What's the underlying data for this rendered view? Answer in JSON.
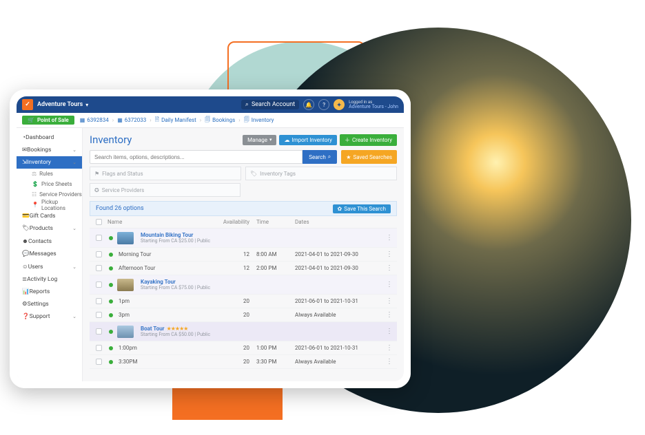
{
  "topbar": {
    "app": "Adventure Tours",
    "search_label": "Search Account",
    "logged_in_as": "Logged in as",
    "user_line": "Adventure Tours - John"
  },
  "pos_label": "Point of Sale",
  "breadcrumbs": [
    {
      "text": "6392834"
    },
    {
      "text": "6372033"
    },
    {
      "text": "Daily Manifest"
    },
    {
      "text": "Bookings"
    },
    {
      "text": "Inventory"
    }
  ],
  "sidebar": {
    "items": [
      {
        "label": "Dashboard"
      },
      {
        "label": "Bookings",
        "expandable": true
      },
      {
        "label": "Inventory",
        "expandable": true,
        "active": true,
        "children": [
          {
            "label": "Rules"
          },
          {
            "label": "Price Sheets"
          },
          {
            "label": "Service Providers"
          },
          {
            "label": "Pickup Locations"
          }
        ]
      },
      {
        "label": "Gift Cards"
      },
      {
        "label": "Products",
        "expandable": true
      },
      {
        "label": "Contacts"
      },
      {
        "label": "Messages"
      },
      {
        "label": "Users",
        "expandable": true
      },
      {
        "label": "Activity Log"
      },
      {
        "label": "Reports"
      },
      {
        "label": "Settings"
      },
      {
        "label": "Support",
        "expandable": true
      }
    ]
  },
  "page_title": "Inventory",
  "buttons": {
    "manage": "Manage",
    "import": "Import Inventory",
    "create": "Create Inventory",
    "saved_searches": "Saved Searches"
  },
  "search": {
    "placeholder": "Search items, options, descriptions...",
    "label": "Search"
  },
  "filters": {
    "flags": "Flags and Status",
    "tags": "Inventory Tags",
    "providers": "Service Providers"
  },
  "found": {
    "text": "Found 26 options",
    "save": "Save This Search"
  },
  "columns": {
    "name": "Name",
    "availability": "Availability",
    "time": "Time",
    "dates": "Dates"
  },
  "rows": [
    {
      "type": "prod",
      "name": "Mountain Biking Tour",
      "sub": "Starting From CA $25.00  |  Public",
      "thumb": "m"
    },
    {
      "type": "opt",
      "name": "Morning Tour",
      "av": "12",
      "time": "8:00 AM",
      "dates": "2021-04-01 to 2021-09-30"
    },
    {
      "type": "opt",
      "name": "Afternoon Tour",
      "av": "12",
      "time": "2:00 PM",
      "dates": "2021-04-01 to 2021-09-30"
    },
    {
      "type": "prod",
      "name": "Kayaking Tour",
      "sub": "Starting From CA $75.00  |  Public",
      "thumb": "k"
    },
    {
      "type": "opt",
      "name": "1pm",
      "av": "20",
      "time": "",
      "dates": "2021-06-01 to 2021-10-31"
    },
    {
      "type": "opt",
      "name": "3pm",
      "av": "20",
      "time": "",
      "dates": "Always Available"
    },
    {
      "type": "prod",
      "name": "Boat Tour",
      "sub": "Starting From CA $50.00  |  Public",
      "thumb": "b",
      "stars": 5,
      "alt": true
    },
    {
      "type": "opt",
      "name": "1:00pm",
      "av": "20",
      "time": "1:00 PM",
      "dates": "2021-06-01 to 2021-10-31"
    },
    {
      "type": "opt",
      "name": "3:30PM",
      "av": "20",
      "time": "3:30 PM",
      "dates": "Always Available"
    }
  ]
}
